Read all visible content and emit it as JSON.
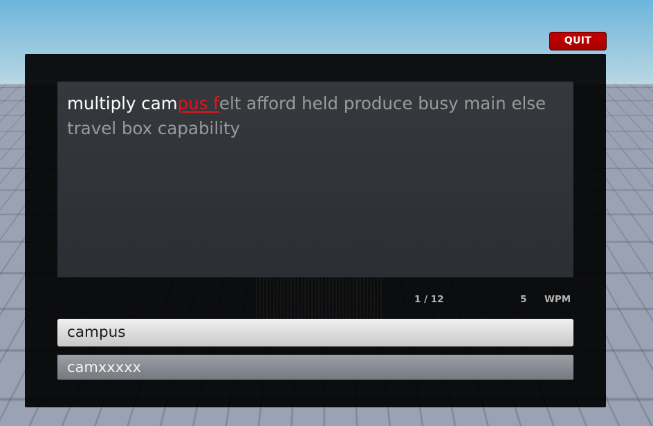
{
  "quit_button": {
    "label": "QUIT"
  },
  "prompt": {
    "typed": "multiply cam",
    "error": "pus f",
    "remaining": "elt afford held produce busy main else travel box capability"
  },
  "stats": {
    "progress": "1 / 12",
    "wpm_value": "5",
    "wpm_label": "WPM"
  },
  "input": {
    "value": "campus"
  },
  "preview": {
    "value": "camxxxxx"
  },
  "colors": {
    "quit_red": "#c40000",
    "error_red": "#e0141e",
    "typed_text": "#ffffff",
    "pending_text": "#9a9a9a"
  }
}
